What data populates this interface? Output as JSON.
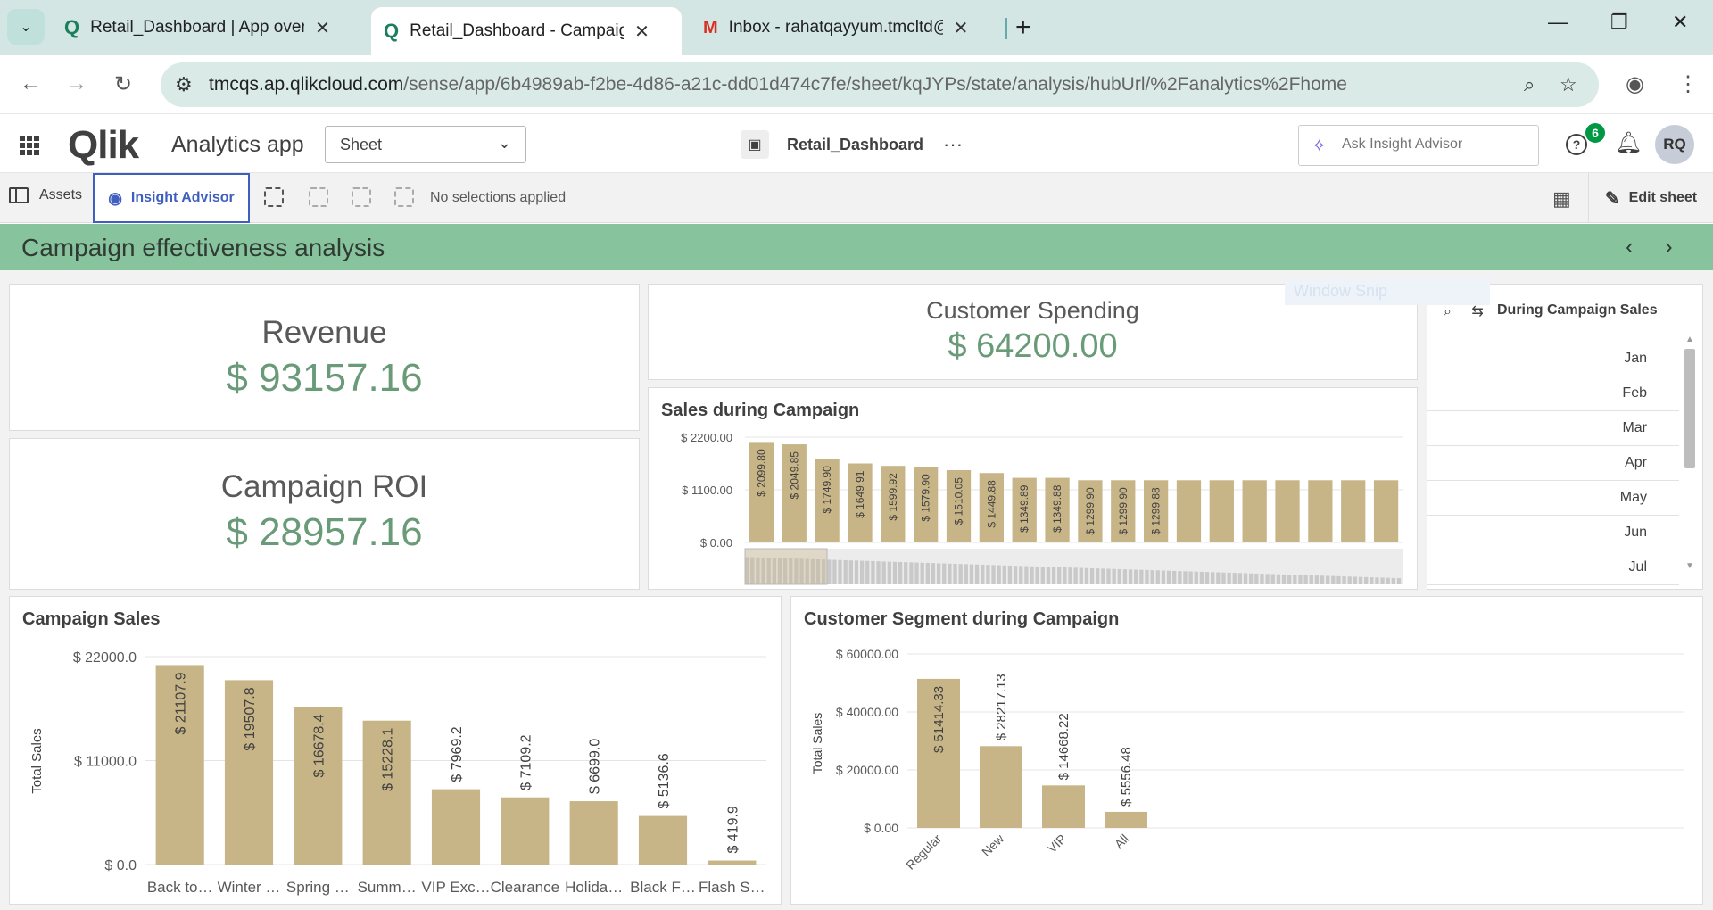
{
  "browser": {
    "tabs": [
      {
        "title": "Retail_Dashboard | App overview",
        "active": false,
        "icon": "qlik-icon"
      },
      {
        "title": "Retail_Dashboard - Campaign effectiveness analysis",
        "active": true,
        "icon": "qlik-icon"
      },
      {
        "title": "Inbox - rahatqayyum.tmcltd@gmail.com",
        "active": false,
        "icon": "gmail-icon"
      }
    ],
    "url_host": "tmcqs.ap.qlikcloud.com",
    "url_path": "/sense/app/6b4989ab-f2be-4d86-a21c-dd01d474c7fe/sheet/kqJYPs/state/analysis/hubUrl/%2Fanalytics%2Fhome"
  },
  "qlik_header": {
    "logo": "Qlik",
    "app_title": "Analytics app",
    "sheet_select": "Sheet",
    "app_name": "Retail_Dashboard",
    "insight_placeholder": "Ask Insight Advisor",
    "notification_count": "6",
    "avatar_initials": "RQ"
  },
  "toolbar": {
    "assets_label": "Assets",
    "insight_label": "Insight Advisor",
    "no_selections": "No selections applied",
    "edit_sheet": "Edit sheet"
  },
  "sheet": {
    "title": "Campaign effectiveness analysis"
  },
  "kpis": {
    "revenue": {
      "label": "Revenue",
      "value": "$ 93157.16"
    },
    "campaign_roi": {
      "label": "Campaign ROI",
      "value": "$ 28957.16"
    },
    "customer_spending": {
      "label": "Customer Spending",
      "value": "$ 64200.00"
    }
  },
  "overlay_text": "Window Snip",
  "filter_pane": {
    "title": "During Campaign Sales",
    "items": [
      "Jan",
      "Feb",
      "Mar",
      "Apr",
      "May",
      "Jun",
      "Jul"
    ]
  },
  "colors": {
    "bar": "#c8b587",
    "kpi_value": "#6a9b79",
    "sheet_bar": "#87c49e",
    "accent": "#3f5fc0"
  },
  "chart_data": [
    {
      "id": "sales-during-campaign",
      "type": "bar",
      "title": "Sales during Campaign",
      "ylim": [
        0,
        2200
      ],
      "yticks": [
        "$ 2200.00",
        "$ 1100.00",
        "$ 0.00"
      ],
      "values": [
        2099.8,
        2049.85,
        1749.9,
        1649.91,
        1599.92,
        1579.9,
        1510.05,
        1449.88,
        1349.89,
        1349.88,
        1299.9,
        1299.9,
        1299.88,
        1299.88,
        1299.88,
        1299.88,
        1299.88,
        1299.88,
        1299.88,
        1299.88
      ],
      "data_labels": [
        "$ 2099.80",
        "$ 2049.85",
        "$ 1749.90",
        "$ 1649.91",
        "$ 1599.92",
        "$ 1579.90",
        "$ 1510.05",
        "$ 1449.88",
        "$ 1349.89",
        "$ 1349.88",
        "$ 1299.90",
        "$ 1299.90",
        "$ 1299.88"
      ],
      "mini_chart": true
    },
    {
      "id": "campaign-sales",
      "type": "bar",
      "title": "Campaign Sales",
      "ylabel": "Total Sales",
      "ylim": [
        0,
        22000
      ],
      "yticks": [
        "$ 22000.0",
        "$ 11000.0",
        "$ 0.0"
      ],
      "categories": [
        "Back to…",
        "Winter …",
        "Spring …",
        "Summ…",
        "VIP Exc…",
        "Clearance",
        "Holida…",
        "Black F…",
        "Flash S…"
      ],
      "values": [
        21107.9,
        19507.8,
        16678.4,
        15228.1,
        7969.2,
        7109.2,
        6699.0,
        5136.6,
        419.9
      ],
      "data_labels": [
        "$ 21107.9",
        "$ 19507.8",
        "$ 16678.4",
        "$ 15228.1",
        "$ 7969.2",
        "$ 7109.2",
        "$ 6699.0",
        "$ 5136.6",
        "$ 419.9"
      ]
    },
    {
      "id": "customer-segment",
      "type": "bar",
      "title": "Customer Segment during Campaign",
      "ylabel": "Total Sales",
      "ylim": [
        0,
        60000
      ],
      "yticks": [
        "$ 60000.00",
        "$ 40000.00",
        "$ 20000.00",
        "$ 0.00"
      ],
      "categories": [
        "Regular",
        "New",
        "VIP",
        "All"
      ],
      "values": [
        51414.33,
        28217.13,
        14668.22,
        5556.48
      ],
      "data_labels": [
        "$ 51414.33",
        "$ 28217.13",
        "$ 14668.22",
        "$ 5556.48"
      ]
    }
  ]
}
